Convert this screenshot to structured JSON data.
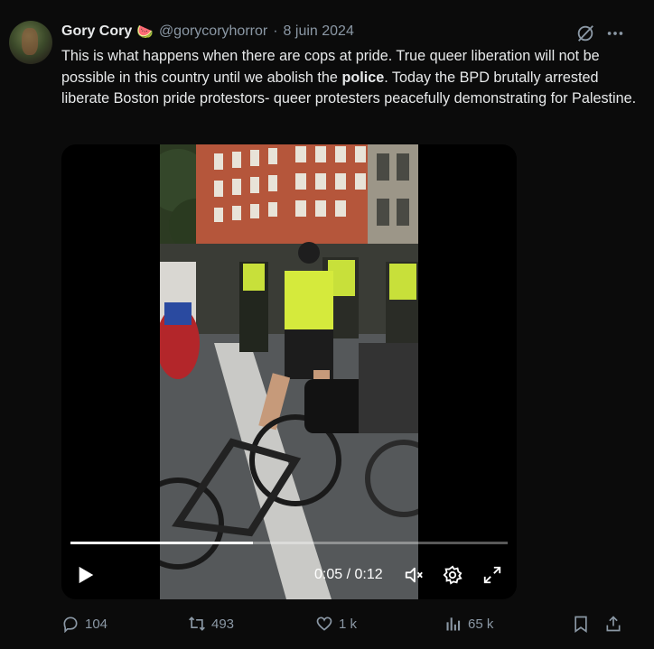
{
  "post": {
    "author_name": "Gory Cory",
    "author_emoji": "🍉",
    "handle": "@gorycoryhorror",
    "separator": "·",
    "date": "8 juin 2024",
    "text_before_bold": "This is what happens when there are cops at pride. True queer liberation will not be possible in this country until we abolish the ",
    "text_bold": "police",
    "text_after_bold": ". Today the BPD brutally arrested liberate Boston pride protestors- queer protesters peacefully demonstrating for Palestine."
  },
  "video": {
    "time_display": "0:05 / 0:12",
    "progress": 0.4167,
    "accent_color": "#ffffff"
  },
  "actions": {
    "replies": "104",
    "reposts": "493",
    "likes": "1 k",
    "views": "65 k"
  },
  "icons": [
    "grok-icon",
    "more-icon",
    "play-icon",
    "volume-icon",
    "settings-icon",
    "fullscreen-icon",
    "reply-icon",
    "repost-icon",
    "like-icon",
    "views-icon",
    "bookmark-icon",
    "share-icon"
  ]
}
